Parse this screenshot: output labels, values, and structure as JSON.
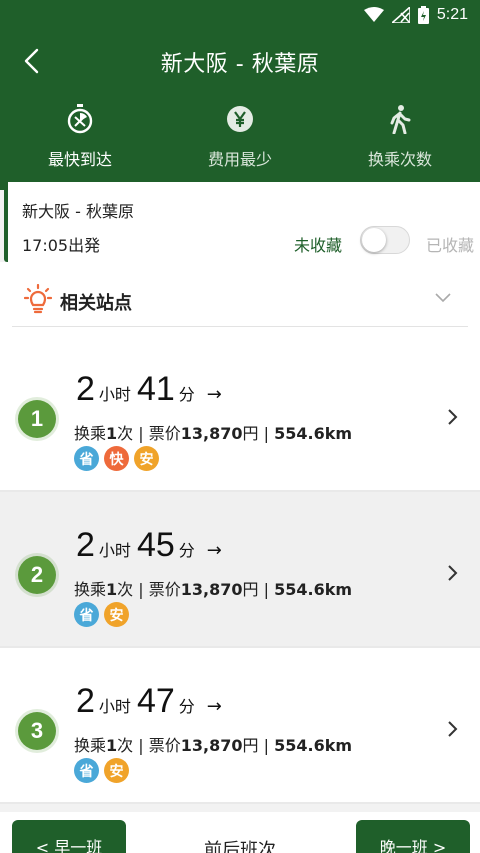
{
  "status_bar": {
    "time": "5:21"
  },
  "header": {
    "title": "新大阪 - 秋葉原"
  },
  "tabs": [
    {
      "label": "最快到达",
      "icon": "stopwatch-icon",
      "active": true
    },
    {
      "label": "费用最少",
      "icon": "yen-icon",
      "active": false
    },
    {
      "label": "换乘次数",
      "icon": "walking-icon",
      "active": false
    }
  ],
  "info": {
    "route": "新大阪 - 秋葉原",
    "departure": "17:05出発",
    "unsaved_label": "未收藏",
    "saved_label": "已收藏"
  },
  "related": {
    "label": "相关站点"
  },
  "routes": [
    {
      "index": "1",
      "hours": "2",
      "hours_unit": "小时",
      "minutes": "41",
      "minutes_unit": "分",
      "arrow": "→",
      "transfer": "换乘",
      "transfer_count": "1",
      "transfer_unit": "次",
      "sep": "|",
      "fare_label": "票价",
      "fare": "13,870",
      "fare_unit": "円",
      "distance": "554.6km",
      "tags": [
        {
          "text": "省",
          "color": "#4aa8d8"
        },
        {
          "text": "快",
          "color": "#ee6a3b"
        },
        {
          "text": "安",
          "color": "#f0a32a"
        }
      ]
    },
    {
      "index": "2",
      "hours": "2",
      "hours_unit": "小时",
      "minutes": "45",
      "minutes_unit": "分",
      "arrow": "→",
      "transfer": "换乘",
      "transfer_count": "1",
      "transfer_unit": "次",
      "sep": "|",
      "fare_label": "票价",
      "fare": "13,870",
      "fare_unit": "円",
      "distance": "554.6km",
      "tags": [
        {
          "text": "省",
          "color": "#4aa8d8"
        },
        {
          "text": "安",
          "color": "#f0a32a"
        }
      ]
    },
    {
      "index": "3",
      "hours": "2",
      "hours_unit": "小时",
      "minutes": "47",
      "minutes_unit": "分",
      "arrow": "→",
      "transfer": "换乘",
      "transfer_count": "1",
      "transfer_unit": "次",
      "sep": "|",
      "fare_label": "票价",
      "fare": "13,870",
      "fare_unit": "円",
      "distance": "554.6km",
      "tags": [
        {
          "text": "省",
          "color": "#4aa8d8"
        },
        {
          "text": "安",
          "color": "#f0a32a"
        }
      ]
    }
  ],
  "bottom_bar": {
    "prev_label": "< 早一班",
    "center_label": "前后班次",
    "next_label": "晚一班 >"
  },
  "colors": {
    "primary": "#1f5f2a",
    "badge": "#5b9a3c"
  }
}
